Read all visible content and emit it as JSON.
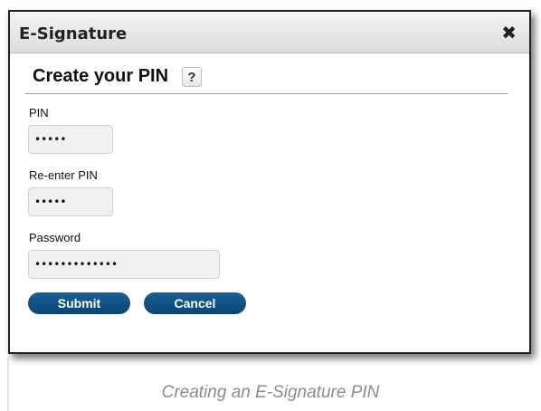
{
  "dialog": {
    "title": "E-Signature",
    "close_glyph": "✖",
    "heading": "Create your PIN",
    "help_label": "?"
  },
  "fields": {
    "pin": {
      "label": "PIN",
      "value": "•••••"
    },
    "reenter_pin": {
      "label": "Re-enter PIN",
      "value": "•••••"
    },
    "password": {
      "label": "Password",
      "value": "•••••••••••••"
    }
  },
  "buttons": {
    "submit_label": "Submit",
    "cancel_label": "Cancel"
  },
  "caption": "Creating an E-Signature PIN",
  "colors": {
    "button_bg": "#0b4474",
    "caption_text": "#8c8c8c",
    "input_bg": "#f0f0f0"
  },
  "icons": {
    "close": "close-icon",
    "help": "help-icon"
  }
}
